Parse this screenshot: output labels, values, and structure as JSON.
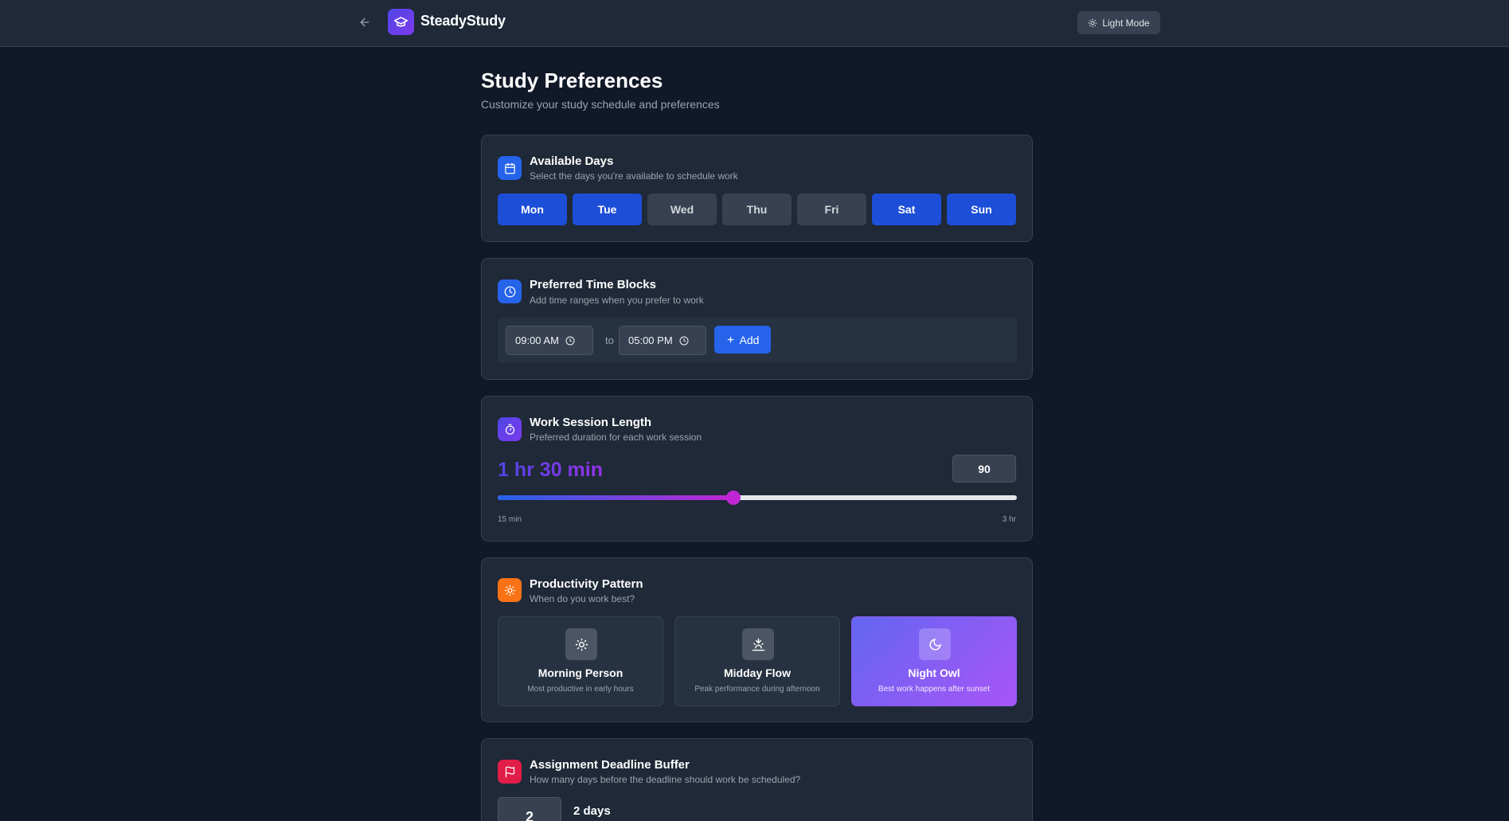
{
  "header": {
    "brand": "SteadyStudy",
    "mode_button": "Light Mode"
  },
  "page": {
    "title": "Study Preferences",
    "subtitle": "Customize your study schedule and preferences"
  },
  "available_days": {
    "title": "Available Days",
    "description": "Select the days you're available to schedule work",
    "days": [
      {
        "label": "Mon",
        "selected": true
      },
      {
        "label": "Tue",
        "selected": true
      },
      {
        "label": "Wed",
        "selected": false
      },
      {
        "label": "Thu",
        "selected": false
      },
      {
        "label": "Fri",
        "selected": false
      },
      {
        "label": "Sat",
        "selected": true
      },
      {
        "label": "Sun",
        "selected": true
      }
    ]
  },
  "time_blocks": {
    "title": "Preferred Time Blocks",
    "description": "Add time ranges when you prefer to work",
    "start": "09:00 AM",
    "separator": "to",
    "end": "05:00 PM",
    "add_label": "Add"
  },
  "session": {
    "title": "Work Session Length",
    "description": "Preferred duration for each work session",
    "display": "1 hr 30 min",
    "minutes": "90",
    "min_minutes": 15,
    "max_minutes": 180,
    "min_label": "15 min",
    "max_label": "3 hr"
  },
  "productivity": {
    "title": "Productivity Pattern",
    "description": "When do you work best?",
    "options": [
      {
        "name": "Morning Person",
        "desc": "Most productive in early hours",
        "icon": "sun-icon",
        "selected": false
      },
      {
        "name": "Midday Flow",
        "desc": "Peak performance during afternoon",
        "icon": "sunset-icon",
        "selected": false
      },
      {
        "name": "Night Owl",
        "desc": "Best work happens after sunset",
        "icon": "moon-icon",
        "selected": true
      }
    ]
  },
  "buffer": {
    "title": "Assignment Deadline Buffer",
    "description": "How many days before the deadline should work be scheduled?",
    "value": "2",
    "label": "2 days"
  },
  "colors": {
    "accent_blue": "#1d4ed8",
    "accent_purple": "#9333ea",
    "background": "#111827",
    "card": "#1f2937"
  }
}
